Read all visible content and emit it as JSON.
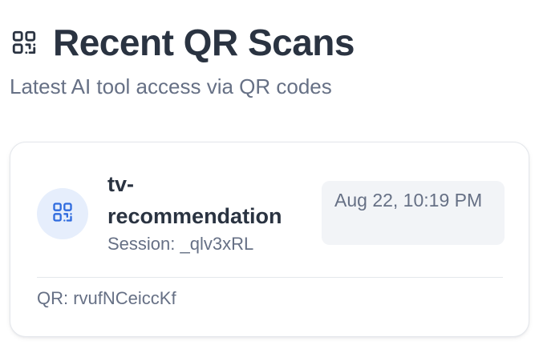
{
  "header": {
    "title": "Recent QR Scans",
    "subtitle": "Latest AI tool access via QR codes",
    "icon": "qr-code-icon",
    "title_color": "#2a3341"
  },
  "scan": {
    "tool_name": "tv-recommendation",
    "session_label": "Session: _qlv3xRL",
    "time": "Aug 22, 10:19 PM",
    "qr_label": "QR: rvufNCeiccKf",
    "icon": "qr-code-icon",
    "accent_color": "#2f6bde",
    "avatar_bg": "#e6eefc"
  }
}
